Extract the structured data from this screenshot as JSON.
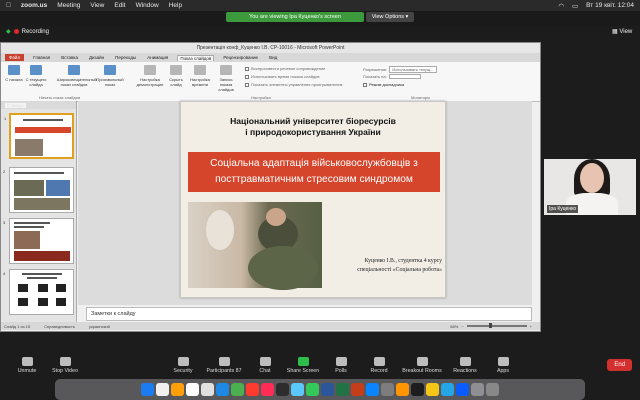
{
  "menubar": {
    "app": "zoom.us",
    "items": [
      "Meeting",
      "View",
      "Edit",
      "Window",
      "Help"
    ],
    "clock": "Вт 19 квіт.  12:04"
  },
  "share": {
    "banner": "You are viewing Іра Куценко's screen",
    "view_options": "View Options ▾"
  },
  "recording": "Recording",
  "view_button": "View",
  "ppt": {
    "title": "Презентація конф_Куценко І.В. СР-10016 - Microsoft PowerPoint",
    "tabs": [
      "Файл",
      "Главная",
      "Вставка",
      "Дизайн",
      "Переходы",
      "Анимация",
      "Показ слайдов",
      "Рецензирование",
      "Вид"
    ],
    "active_tab": "Показ слайдов",
    "ribbon_buttons": [
      "С начала",
      "С текущего слайда",
      "Широковещательный показ слайдов",
      "Произвольный показ",
      "Настройка демонстрации",
      "Скрыть слайд",
      "Настройка времени",
      "Запись показа слайдов"
    ],
    "ribbon_groups": [
      "Начать показ слайдов",
      "Настройка",
      "Мониторы"
    ],
    "checkboxes": [
      "Воспроизвести речевое сопровождение",
      "Использовать время показа слайдов",
      "Показать элементы управления проигрывателем"
    ],
    "monitors": {
      "resolution_label": "Разрешение:",
      "resolution_value": "Использовать текущ...",
      "show_on_label": "Показать на:",
      "presenter_view": "Режим докладчика"
    },
    "panel_tabs": [
      "Слайды",
      "Структура"
    ],
    "slide": {
      "title_line1": "Національний університет біоресурсів",
      "title_line2": "і природокористування України",
      "subtitle_line1": "Соціальна адаптація військовослужбовців з",
      "subtitle_line2": "посттравматичним стресовим синдромом",
      "author_line1": "Куценко І.В., студентка 4 курсу",
      "author_line2": "спеціальності «Соціальна робота»"
    },
    "thumbnails": [
      "1",
      "2",
      "3",
      "4"
    ],
    "notes_placeholder": "Заметки к слайду",
    "status": {
      "slide_counter": "Слайд 1 из 15",
      "theme": "Справедливость",
      "language": "украинский",
      "zoom": "68%",
      "zoom_fraction": 0.4
    }
  },
  "video": {
    "name": "Іра Куценко"
  },
  "toolbar": {
    "items": [
      "Unmute",
      "Stop Video",
      "Security",
      "Participants",
      "Chat",
      "Share Screen",
      "Polls",
      "Record",
      "Breakout Rooms",
      "Reactions",
      "Apps"
    ],
    "participants_count": "87",
    "end": "End"
  },
  "dock_colors": [
    "#1b7cf2",
    "#f0f0f0",
    "#ff9f0a",
    "#ffffff",
    "#e0e0e0",
    "#1e88e5",
    "#4caf50",
    "#ff3b30",
    "#ff2d55",
    "#2d2d2d",
    "#5ac8fa",
    "#34c759",
    "#2b579a",
    "#217346",
    "#c43e1c",
    "#0a84ff",
    "#7d7d7d",
    "#ff9500",
    "#1d1d1f",
    "#f5c518",
    "#26a5e4",
    "#0b5cff",
    "#8e8e93",
    "#888888"
  ]
}
